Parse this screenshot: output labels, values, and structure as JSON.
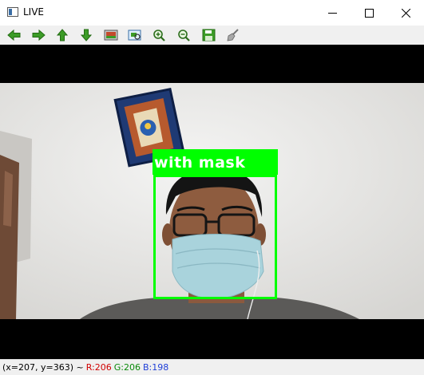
{
  "window": {
    "title": "LIVE"
  },
  "controls": {
    "minimize_icon": "minimize-icon",
    "maximize_icon": "maximize-icon",
    "close_icon": "close-icon"
  },
  "toolbar": {
    "tools": [
      "pan-left-icon",
      "pan-right-icon",
      "pan-up-icon",
      "pan-down-icon",
      "reset-image-icon",
      "zoom-region-icon",
      "zoom-in-icon",
      "zoom-out-icon",
      "save-icon",
      "properties-icon"
    ]
  },
  "detection": {
    "label": "with mask",
    "color": "#00ff00"
  },
  "statusbar": {
    "coords": "(x=207, y=363) ~",
    "r": "R:206",
    "g": "G:206",
    "b": "B:198"
  }
}
